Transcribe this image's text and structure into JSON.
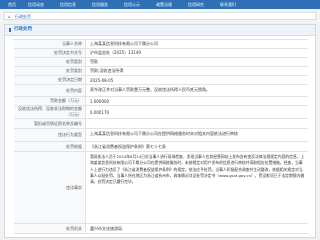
{
  "nav": {
    "items": [
      "首页",
      "信用动态",
      "信用信息",
      "信用服务",
      "信用公示",
      "政策法规",
      "信用研究",
      "联系我们"
    ]
  },
  "breadcrumb": "行政处罚",
  "panel": {
    "title": "行政处罚"
  },
  "fields": [
    {
      "label": "当事人名称",
      "value": "上海某某信息科技有限公司下属分公司"
    },
    {
      "label": "处罚决定书文号",
      "value": "沪市监金处〔2025〕13149"
    },
    {
      "label": "处罚类别",
      "value": "罚款"
    },
    {
      "label": "处罚类别",
      "value": "罚款;没收违法所得"
    },
    {
      "label": "处罚决定日期",
      "value": "2025-08-05"
    },
    {
      "label": "处罚内容",
      "value": "责令改正并对当事人罚款壹万元整，没收违法所得人民币贰元捌角。"
    },
    {
      "label": "罚款金额（万元）",
      "value": "1.000000"
    },
    {
      "label": "没收违法所得、没收非法财物的金额（万元）",
      "value": "0.000170"
    },
    {
      "label": "暂扣或吊销证照名称及编号",
      "value": ""
    },
    {
      "label": "违法行为类型",
      "value": "上海某某信息科技有限公司下属分公司在提供网络服务时未对相关内容依法进行审核"
    },
    {
      "label": "处罚依据",
      "value": "《浙江省消费者权益保护条例》第七十七条"
    },
    {
      "label": "违法事实",
      "value": "我局执法人员于2024年8月14日对当事人进行现场检查，发现当事人在其经营网站上发布含有违反法律法规规定内容的信息，上海某某信息科技有限公司下属分公司在提供网络服务时，未按规定对用户发布的信息进行审核并采取相应处置措施。经查，当事人上述行为违反了《浙江省消费者权益保护条例》的规定，依法应予处罚。当事人积极配合调查并主动整改，依据相关规定对当事人从轻处罚。当事人所在地区为浙江省杭州市，具体情况详见处罚决定书（www.gsxt.gov.cn），罚没款项已于法定期限内缴清，处罚决定已履行完毕。"
    },
    {
      "label": "处罚机关",
      "value": "嘉兴市文化旅游局"
    }
  ]
}
